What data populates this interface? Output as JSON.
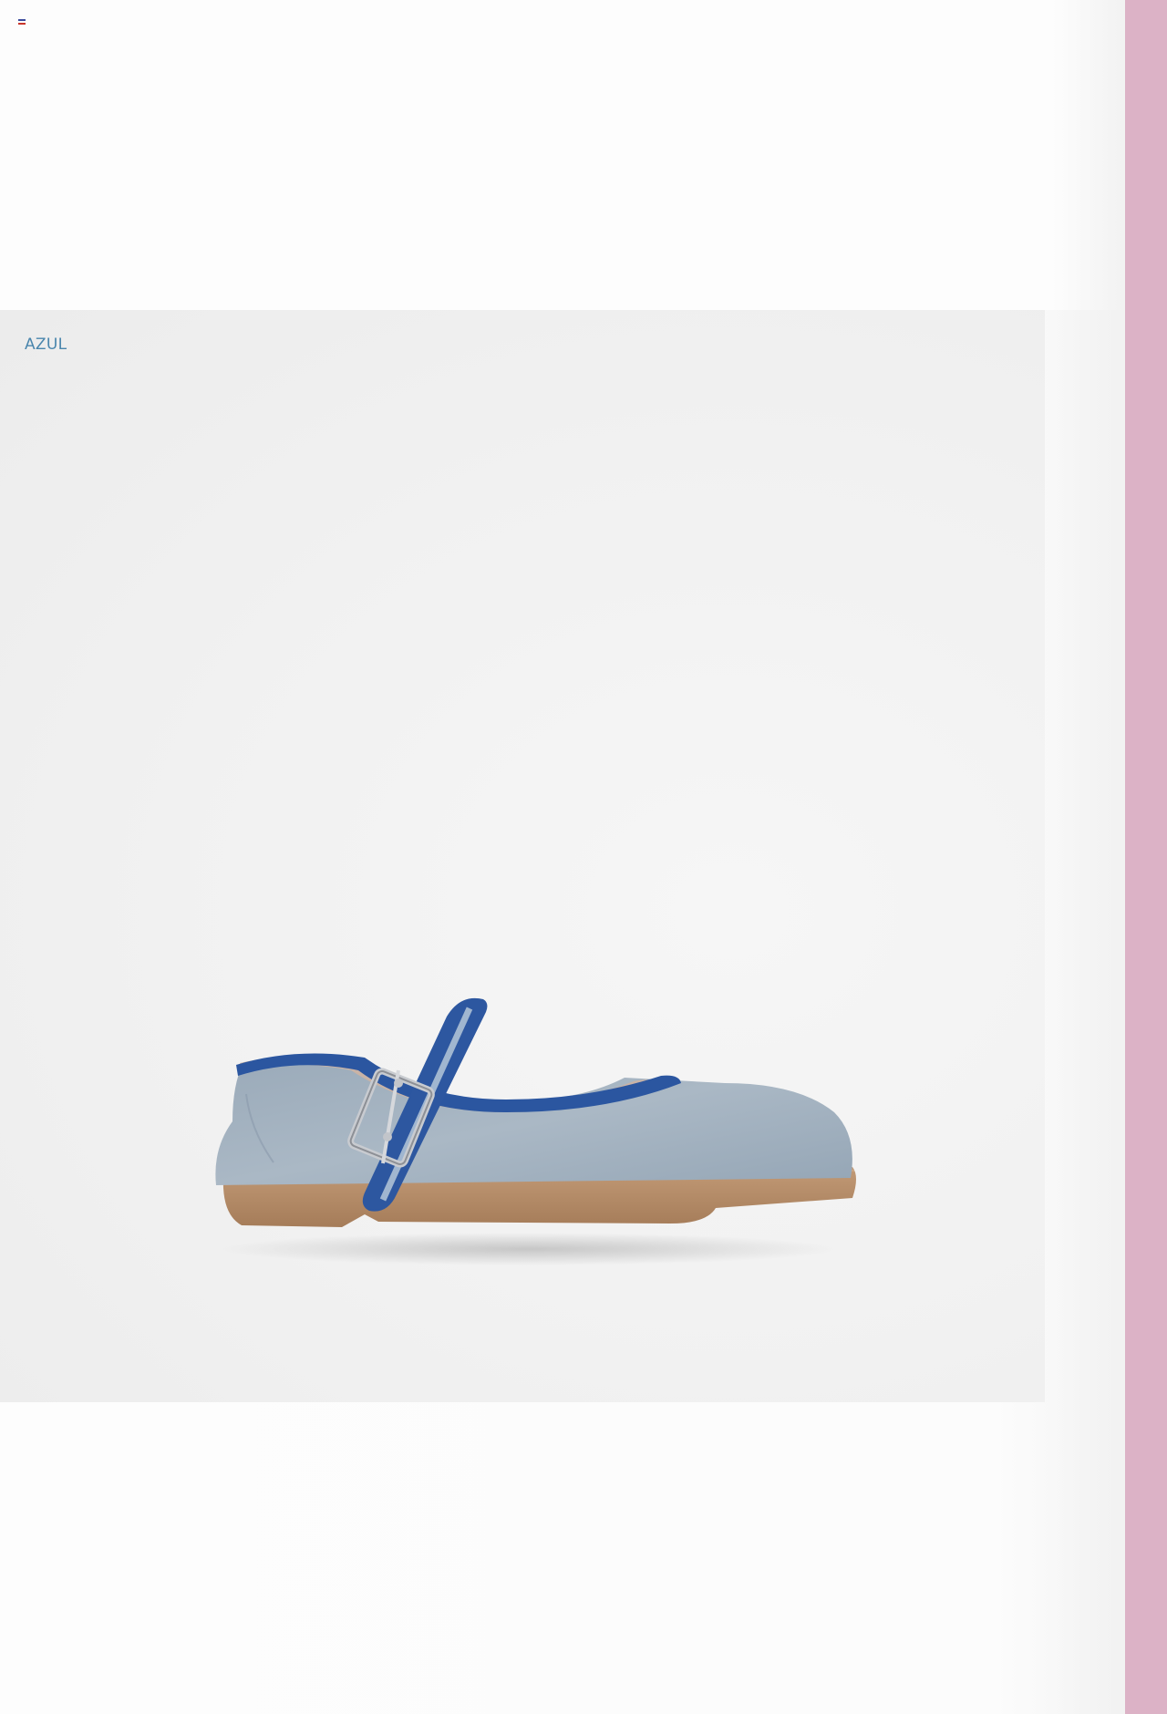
{
  "header": {
    "language_flag_icon": "flag-icon"
  },
  "product": {
    "color_label": "AZUL",
    "image_alt_icon": "mary-jane-shoe-image"
  },
  "colors": {
    "accent_label": "#4a86ad",
    "side_stripe": "#dcb2c6",
    "shoe_upper": "#a3b2c0",
    "shoe_trim": "#2d57a0",
    "shoe_sole": "#b38a66"
  }
}
